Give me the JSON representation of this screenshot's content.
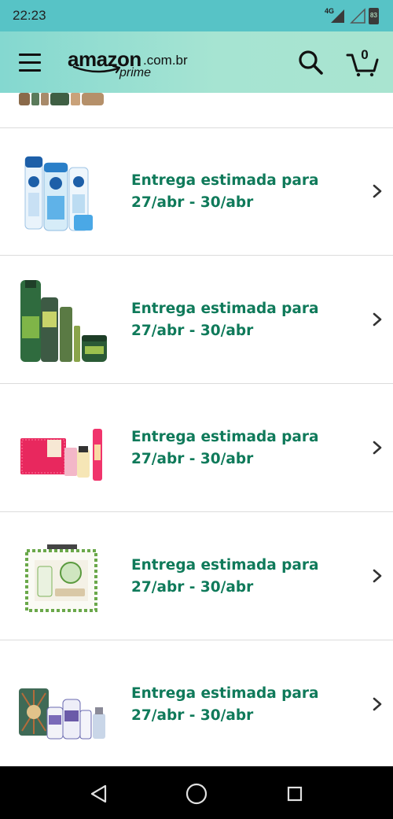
{
  "status_bar": {
    "time": "22:23",
    "network": "4G",
    "battery": "83",
    "icons": [
      "signal-4g-icon",
      "signal-icon",
      "battery-icon"
    ]
  },
  "header": {
    "logo": {
      "word": "amazon",
      "domain": ".com.br",
      "sub": "prime"
    },
    "icons": [
      "menu-icon",
      "search-icon",
      "cart-icon"
    ],
    "cart_count": "0",
    "colors": {
      "gradient_start": "#84d8d0",
      "gradient_end": "#a9e4d0"
    }
  },
  "products": [
    {
      "line1": "Entrega estimada para",
      "line2": "27/abr - 30/abr",
      "image": "nivea-facial-kit"
    },
    {
      "line1": "Entrega estimada para",
      "line2": "27/abr - 30/abr",
      "image": "salon-line-hair-kit"
    },
    {
      "line1": "Entrega estimada para",
      "line2": "27/abr - 30/abr",
      "image": "granado-pink-nail-kit"
    },
    {
      "line1": "Entrega estimada para",
      "line2": "27/abr - 30/abr",
      "image": "granado-green-gift-box"
    },
    {
      "line1": "Entrega estimada para",
      "line2": "27/abr - 30/abr",
      "image": "granado-lavender-kit"
    }
  ],
  "colors": {
    "delivery_text": "#0f7a5a",
    "divider": "#dcdcdc"
  },
  "nav_bar": {
    "icons": [
      "back-icon",
      "home-icon",
      "recents-icon"
    ]
  }
}
